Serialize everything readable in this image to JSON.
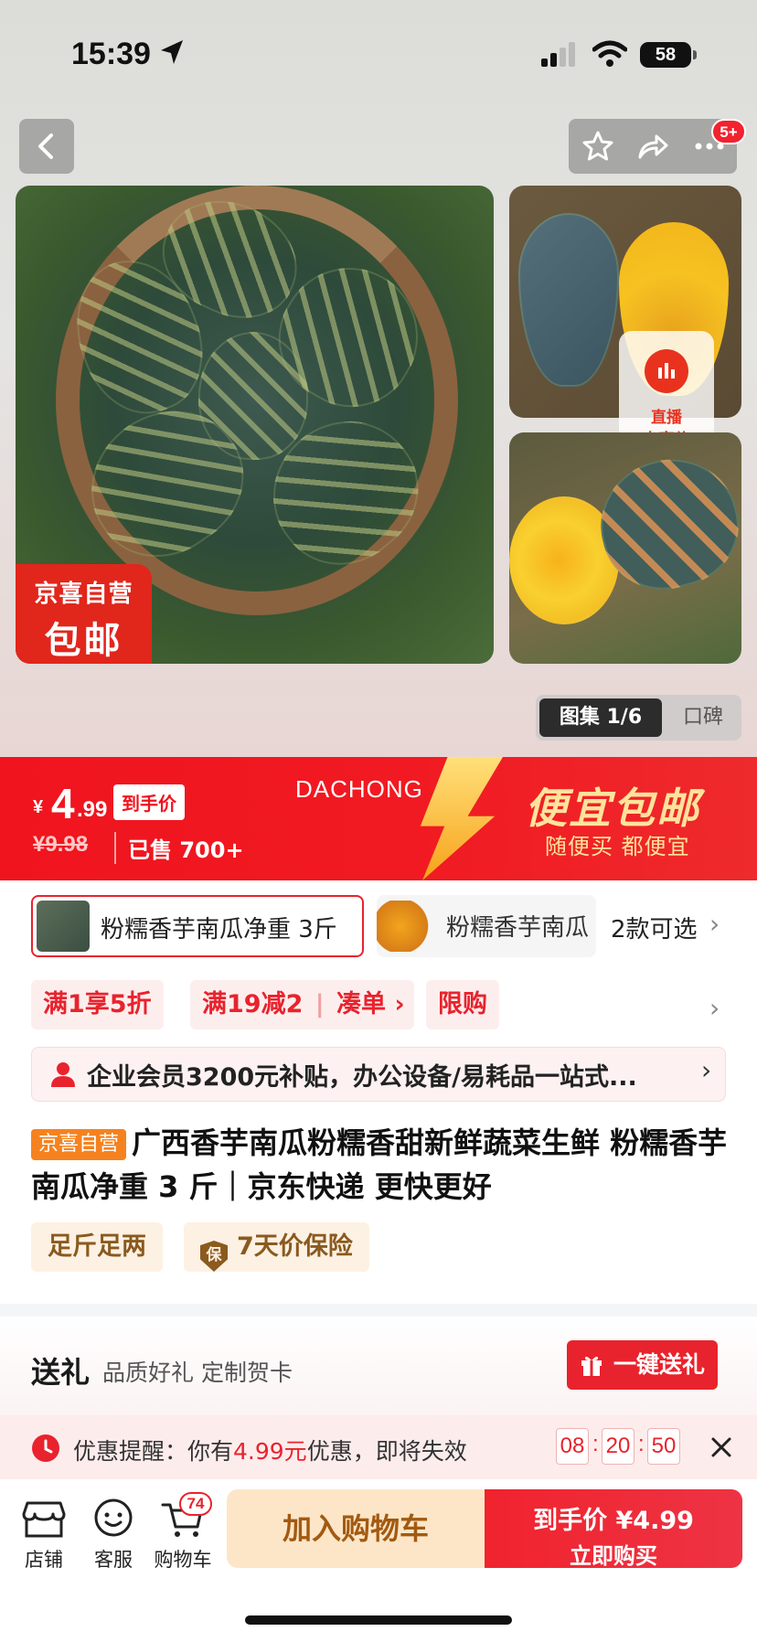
{
  "status_bar": {
    "time": "15:39",
    "battery": "58"
  },
  "nav": {
    "cart_badge": "5+"
  },
  "main_image": {
    "tag_line1": "京喜自营",
    "tag_line2": "包邮"
  },
  "live": {
    "line1": "直播",
    "line2": "专享价"
  },
  "gallery": {
    "label": "图集 1/6",
    "reviews": "口碑"
  },
  "price": {
    "symbol": "¥",
    "integer": "4",
    "decimal": ".99",
    "label": "到手价",
    "original": "¥9.98",
    "sold": "已售 700+",
    "brand": "DACHONG",
    "slogan": "便宜包邮",
    "subslogan": "随便买 都便宜"
  },
  "variants": {
    "selected": "粉糯香芋南瓜净重 3斤",
    "other": "粉糯香芋南瓜",
    "count": "2款可选"
  },
  "promos": [
    "满1享5折",
    "满19减2",
    "凑单",
    "限购"
  ],
  "enterprise": "企业会员3200元补贴，办公设备/易耗品一站式...",
  "title": {
    "tag": "京喜自营",
    "text": "广西香芋南瓜粉糯香甜新鲜蔬菜生鲜 粉糯香芋南瓜净重 3 斤｜京东快递 更快更好"
  },
  "features": {
    "a": "足斤足两",
    "b": "7天价保险",
    "shield": "保"
  },
  "gift": {
    "title": "送礼",
    "subtitle": "品质好礼 定制贺卡",
    "button": "一键送礼"
  },
  "reminder": {
    "prefix": "优惠提醒：你有",
    "amount": "4.99元",
    "suffix": "优惠，即将失效",
    "hh": "08",
    "mm": "20",
    "ss": "50"
  },
  "bottom": {
    "store": "店铺",
    "service": "客服",
    "cart": "购物车",
    "cart_count": "74",
    "add_cart": "加入购物车",
    "buy_label": "到手价 ¥4.99",
    "buy_now": "立即购买"
  },
  "colors": {
    "accent": "#e8232d",
    "band": "#f0141e",
    "gold": "#ffe39b"
  }
}
